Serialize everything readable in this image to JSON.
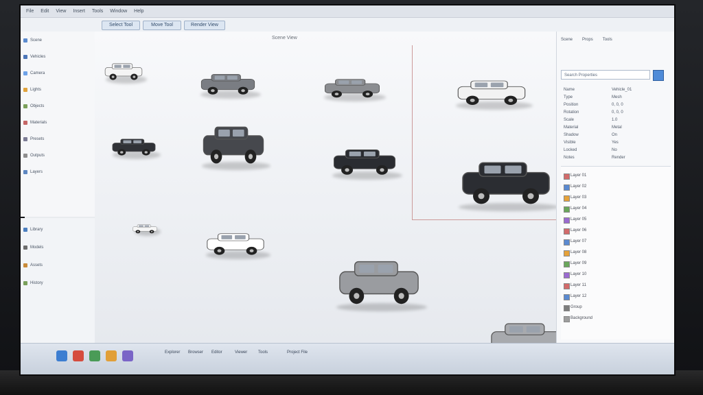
{
  "window": {
    "title": "",
    "menu": [
      "File",
      "Edit",
      "View",
      "Insert",
      "Tools",
      "Window",
      "Help"
    ]
  },
  "toolbar": {
    "buttons": [
      "Select Tool",
      "Move Tool",
      "Render View"
    ]
  },
  "left_tree": [
    {
      "label": "Scene",
      "color": "#5d8ccf"
    },
    {
      "label": "Vehicles",
      "color": "#4d76b8"
    },
    {
      "label": "Camera",
      "color": "#6ea2e8"
    },
    {
      "label": "Lights",
      "color": "#e1a33d"
    },
    {
      "label": "Objects",
      "color": "#7ba05b"
    },
    {
      "label": "Materials",
      "color": "#c56767"
    },
    {
      "label": "Presets",
      "color": "#7d7d95"
    },
    {
      "label": "Outputs",
      "color": "#8e8e8e"
    },
    {
      "label": "Layers",
      "color": "#5e87c1"
    }
  ],
  "left_tree_2": [
    {
      "label": "Library",
      "color": "#4c7fc0"
    },
    {
      "label": "Models",
      "color": "#6d6d6d"
    },
    {
      "label": "Assets",
      "color": "#c98b3a"
    },
    {
      "label": "History",
      "color": "#7aa05b"
    }
  ],
  "canvas": {
    "title": "Scene View"
  },
  "right_panel": {
    "tabs": [
      "Scene",
      "Props",
      "Tools"
    ],
    "search_placeholder": "Search Properties",
    "properties": [
      {
        "name": "Name",
        "value": "Vehicle_01"
      },
      {
        "name": "Type",
        "value": "Mesh"
      },
      {
        "name": "Position",
        "value": "0, 0, 0"
      },
      {
        "name": "Rotation",
        "value": "0, 0, 0"
      },
      {
        "name": "Scale",
        "value": "1.0"
      },
      {
        "name": "Material",
        "value": "Metal"
      },
      {
        "name": "Shadow",
        "value": "On"
      },
      {
        "name": "Visible",
        "value": "Yes"
      },
      {
        "name": "Locked",
        "value": "No"
      },
      {
        "name": "Notes",
        "value": "Render"
      }
    ],
    "layers": [
      {
        "label": "Layer 01",
        "color": "#d36b6b"
      },
      {
        "label": "Layer 02",
        "color": "#5b8ad1"
      },
      {
        "label": "Layer 03",
        "color": "#e6a23a"
      },
      {
        "label": "Layer 04",
        "color": "#6aa75b"
      },
      {
        "label": "Layer 05",
        "color": "#9b6bd1"
      },
      {
        "label": "Layer 06",
        "color": "#d36b6b"
      },
      {
        "label": "Layer 07",
        "color": "#5b8ad1"
      },
      {
        "label": "Layer 08",
        "color": "#e6a23a"
      },
      {
        "label": "Layer 09",
        "color": "#6aa75b"
      },
      {
        "label": "Layer 10",
        "color": "#9b6bd1"
      },
      {
        "label": "Layer 11",
        "color": "#d36b6b"
      },
      {
        "label": "Layer 12",
        "color": "#5b8ad1"
      },
      {
        "label": "Group",
        "color": "#7d7d7d"
      },
      {
        "label": "Background",
        "color": "#9e9e9e"
      }
    ]
  },
  "taskbar": {
    "items": [
      {
        "label": "Explorer",
        "color": "#3d7ed1"
      },
      {
        "label": "Browser",
        "color": "#d54c3e"
      },
      {
        "label": "Editor",
        "color": "#4a9b57"
      },
      {
        "label": "Viewer",
        "color": "#e19f38"
      },
      {
        "label": "Tools",
        "color": "#7a65c7"
      }
    ],
    "center_label": "Project File"
  },
  "cars": [
    {
      "name": "car-suv-white",
      "color": "#f4f4f4"
    },
    {
      "name": "car-wagon-gray",
      "color": "#7a7d83"
    },
    {
      "name": "car-pickup-silver",
      "color": "#8b8d91"
    },
    {
      "name": "car-pickup-white",
      "color": "#f2f2f2"
    },
    {
      "name": "car-sedan-black",
      "color": "#303237"
    },
    {
      "name": "car-suv-dark",
      "color": "#46484d"
    },
    {
      "name": "car-muscle-black",
      "color": "#2a2c31"
    },
    {
      "name": "car-pickup-black",
      "color": "#2b2d32"
    },
    {
      "name": "car-suv-small-white",
      "color": "#ffffff"
    },
    {
      "name": "car-van-silver",
      "color": "#9a9ca0"
    },
    {
      "name": "car-coupe-silver",
      "color": "#a8aaae"
    },
    {
      "name": "car-mini-white",
      "color": "#f6f6f6"
    }
  ]
}
